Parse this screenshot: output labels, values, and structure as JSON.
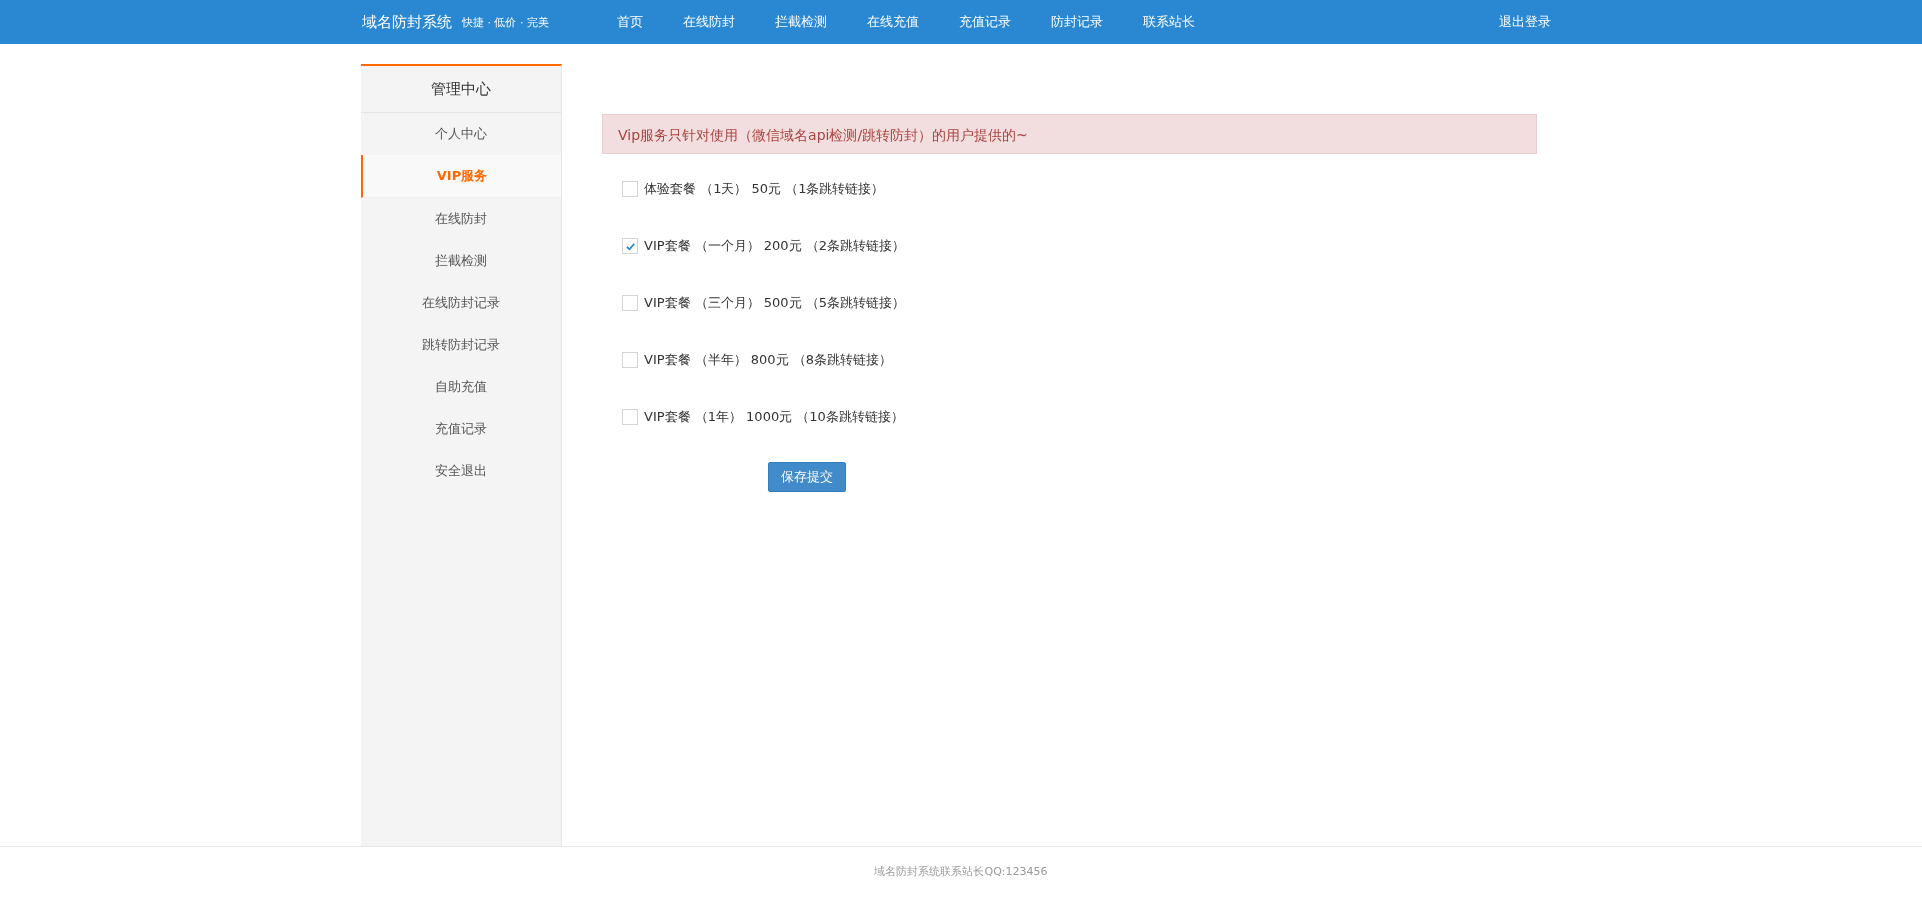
{
  "header": {
    "brand": "域名防封系统",
    "slogan": "快捷 · 低价 · 完美",
    "nav": [
      {
        "label": "首页"
      },
      {
        "label": "在线防封"
      },
      {
        "label": "拦截检测"
      },
      {
        "label": "在线充值"
      },
      {
        "label": "充值记录"
      },
      {
        "label": "防封记录"
      },
      {
        "label": "联系站长"
      }
    ],
    "logout": "退出登录"
  },
  "sidebar": {
    "title": "管理中心",
    "items": [
      {
        "label": "个人中心",
        "selected": false
      },
      {
        "label": "VIP服务",
        "selected": true
      },
      {
        "label": "在线防封",
        "selected": false
      },
      {
        "label": "拦截检测",
        "selected": false
      },
      {
        "label": "在线防封记录",
        "selected": false
      },
      {
        "label": "跳转防封记录",
        "selected": false
      },
      {
        "label": "自助充值",
        "selected": false
      },
      {
        "label": "充值记录",
        "selected": false
      },
      {
        "label": "安全退出",
        "selected": false
      }
    ]
  },
  "notice": "Vip服务只针对使用（微信域名api检测/跳转防封）的用户提供的~",
  "plans": [
    {
      "label": "体验套餐 （1天） 50元 （1条跳转链接）",
      "checked": false
    },
    {
      "label": "VIP套餐 （一个月） 200元 （2条跳转链接）",
      "checked": true
    },
    {
      "label": "VIP套餐 （三个月） 500元 （5条跳转链接）",
      "checked": false
    },
    {
      "label": "VIP套餐 （半年） 800元 （8条跳转链接）",
      "checked": false
    },
    {
      "label": "VIP套餐 （1年） 1000元 （10条跳转链接）",
      "checked": false
    }
  ],
  "submit": "保存提交",
  "footer": "域名防封系统联系站长QQ:123456"
}
